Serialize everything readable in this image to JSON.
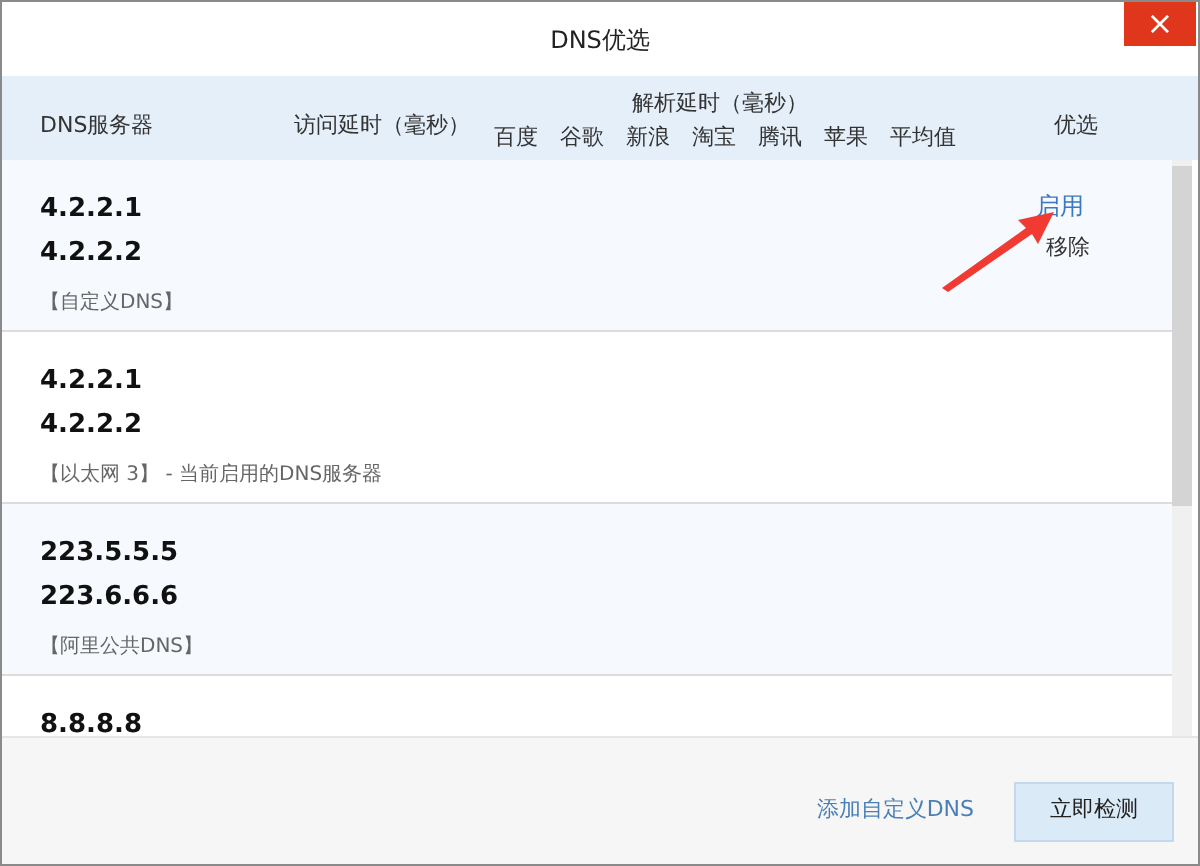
{
  "window": {
    "title": "DNS优选",
    "close": "×"
  },
  "header": {
    "server": "DNS服务器",
    "access_delay": "访问延时（毫秒）",
    "resolve_delay": "解析延时（毫秒）",
    "sites": [
      "百度",
      "谷歌",
      "新浪",
      "淘宝",
      "腾讯",
      "苹果",
      "平均值"
    ],
    "best": "优选"
  },
  "rows": [
    {
      "ips": [
        "4.2.2.1",
        "4.2.2.2"
      ],
      "note": "【自定义DNS】",
      "actions": [
        {
          "label": "启用",
          "kind": "link"
        },
        {
          "label": "移除",
          "kind": "plain"
        }
      ]
    },
    {
      "ips": [
        "4.2.2.1",
        "4.2.2.2"
      ],
      "note": "【以太网 3】 - 当前启用的DNS服务器"
    },
    {
      "ips": [
        "223.5.5.5",
        "223.6.6.6"
      ],
      "note": "【阿里公共DNS】"
    },
    {
      "ips": [
        "8.8.8.8"
      ]
    }
  ],
  "footer": {
    "add_link": "添加自定义DNS",
    "detect_button": "立即检测"
  }
}
